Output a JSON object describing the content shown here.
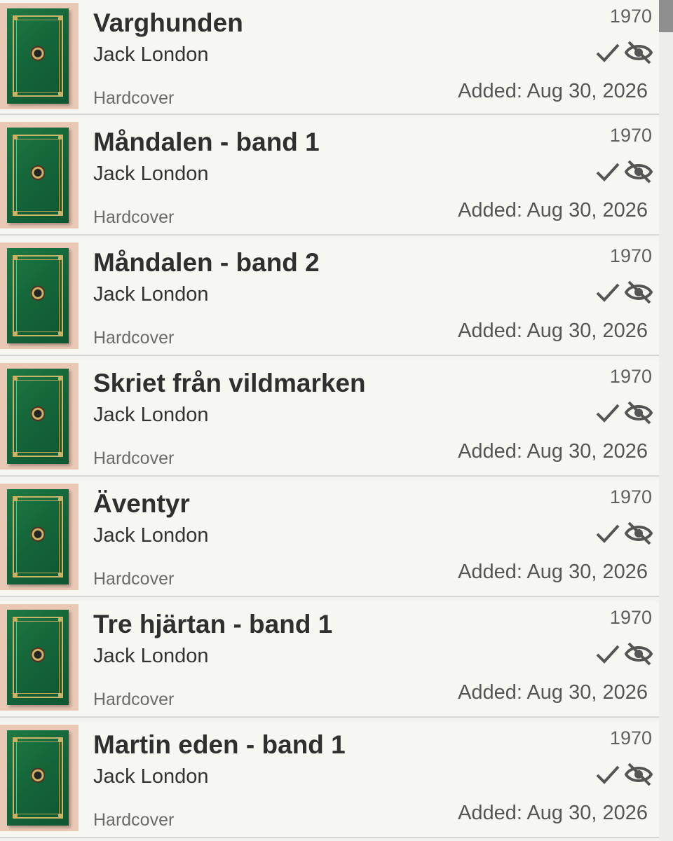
{
  "books": [
    {
      "title": "Varghunden",
      "author": "Jack London",
      "format": "Hardcover",
      "year": "1970",
      "added": "Added: Aug 30, 2026"
    },
    {
      "title": "Måndalen - band 1",
      "author": "Jack London",
      "format": "Hardcover",
      "year": "1970",
      "added": "Added: Aug 30, 2026"
    },
    {
      "title": "Måndalen - band 2",
      "author": "Jack London",
      "format": "Hardcover",
      "year": "1970",
      "added": "Added: Aug 30, 2026"
    },
    {
      "title": "Skriet från vildmarken",
      "author": "Jack London",
      "format": "Hardcover",
      "year": "1970",
      "added": "Added: Aug 30, 2026"
    },
    {
      "title": "Äventyr",
      "author": "Jack London",
      "format": "Hardcover",
      "year": "1970",
      "added": "Added: Aug 30, 2026"
    },
    {
      "title": "Tre hjärtan - band 1",
      "author": "Jack London",
      "format": "Hardcover",
      "year": "1970",
      "added": "Added: Aug 30, 2026"
    },
    {
      "title": "Martin eden - band 1",
      "author": "Jack London",
      "format": "Hardcover",
      "year": "1970",
      "added": "Added: Aug 30, 2026"
    }
  ],
  "icons": {
    "status": "checkmark-icon",
    "visibility": "eye-off-icon"
  },
  "colors": {
    "cover_green": "#1f7a44",
    "gold": "#c9b46a",
    "icon_gray": "#555555"
  }
}
